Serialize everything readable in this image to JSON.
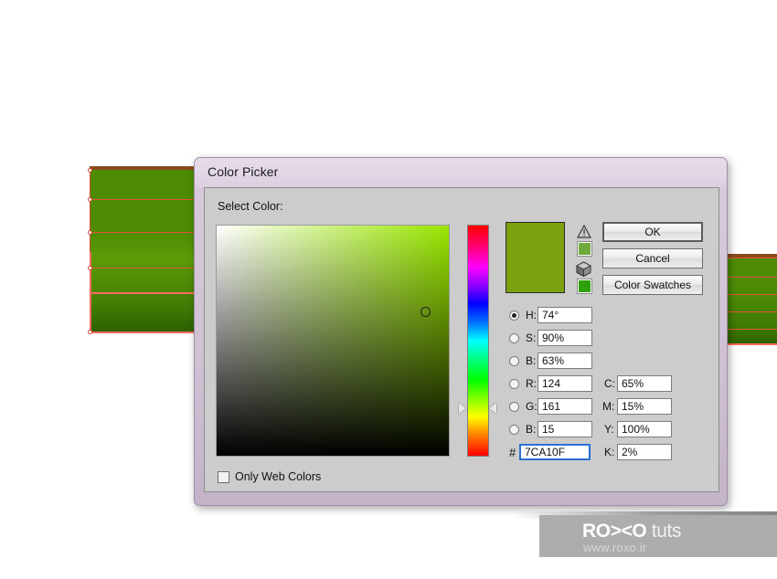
{
  "window": {
    "title": "Color Picker"
  },
  "panel": {
    "select_label": "Select Color:"
  },
  "picker": {
    "hue_color": "#9ae600",
    "picked_color": "#7CA10F",
    "warning_chip_color": "#6fa83d",
    "web_chip_color": "#2ea10a",
    "warning_icon": "out-of-gamut-warning-icon",
    "cube_icon": "web-safe-cube-icon",
    "sb_marker": "saturation-brightness-marker",
    "hue_arrow_left": "hue-slider-arrow-left",
    "hue_arrow_right": "hue-slider-arrow-right"
  },
  "buttons": {
    "ok": "OK",
    "cancel": "Cancel",
    "color_swatches": "Color Swatches"
  },
  "fields": {
    "hsb": [
      {
        "key": "H",
        "label": "H:",
        "value": "74°",
        "selected": true
      },
      {
        "key": "S",
        "label": "S:",
        "value": "90%",
        "selected": false
      },
      {
        "key": "B",
        "label": "B:",
        "value": "63%",
        "selected": false
      }
    ],
    "rgb": [
      {
        "key": "R",
        "label": "R:",
        "value": "124",
        "selected": false
      },
      {
        "key": "G",
        "label": "G:",
        "value": "161",
        "selected": false
      },
      {
        "key": "B",
        "label": "B:",
        "value": "15",
        "selected": false
      }
    ],
    "cmyk": [
      {
        "key": "C",
        "label": "C:",
        "value": "65%"
      },
      {
        "key": "M",
        "label": "M:",
        "value": "15%"
      },
      {
        "key": "Y",
        "label": "Y:",
        "value": "100%"
      },
      {
        "key": "K",
        "label": "K:",
        "value": "2%"
      }
    ],
    "hex": {
      "label": "#",
      "value": "7CA10F",
      "focused": true
    }
  },
  "options": {
    "only_web_colors_label": "Only Web Colors",
    "only_web_colors_checked": false
  },
  "watermark": {
    "brand_bold": "RO><O",
    "brand_light": "tuts",
    "url": "www.roxo.ir"
  },
  "artwork": {
    "fill_color": "#4f8c05",
    "path_color": "#e2553f",
    "path_highlight_color": "#ff6a5e",
    "top_edge_color": "#8a4a1c"
  }
}
